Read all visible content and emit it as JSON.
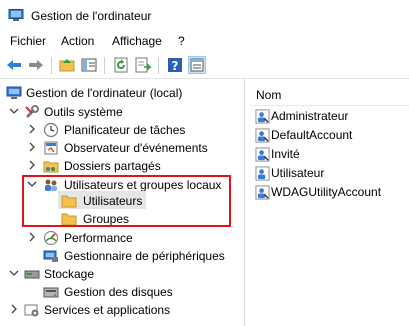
{
  "window": {
    "title": "Gestion de l'ordinateur"
  },
  "menu": [
    {
      "label": "Fichier"
    },
    {
      "label": "Action"
    },
    {
      "label": "Affichage"
    },
    {
      "label": "?"
    }
  ],
  "toolbar": {
    "buttons": [
      {
        "icon": "back-arrow-icon"
      },
      {
        "icon": "forward-arrow-icon"
      },
      {
        "icon": "up-folder-icon"
      },
      {
        "icon": "show-hide-tree-icon"
      },
      {
        "icon": "refresh-icon"
      },
      {
        "icon": "export-list-icon"
      },
      {
        "icon": "help-icon"
      },
      {
        "icon": "properties-icon",
        "active": true
      }
    ]
  },
  "tree": {
    "root": "Gestion de l'ordinateur (local)",
    "system_tools": "Outils système",
    "task_scheduler": "Planificateur de tâches",
    "event_viewer": "Observateur d'événements",
    "shared_folders": "Dossiers partagés",
    "local_users_groups": "Utilisateurs et groupes locaux",
    "users": "Utilisateurs",
    "groups": "Groupes",
    "performance": "Performance",
    "device_manager": "Gestionnaire de périphériques",
    "storage": "Stockage",
    "disk_management": "Gestion des disques",
    "services_apps": "Services et applications",
    "selected": "Utilisateurs"
  },
  "list": {
    "column": "Nom",
    "items": [
      "Administrateur",
      "DefaultAccount",
      "Invité",
      "Utilisateur",
      "WDAGUtilityAccount"
    ]
  },
  "colors": {
    "selection": "#e5e5e5",
    "highlight_border": "#e0141e",
    "folder": "#f2c14e",
    "accent": "#2b6cb0"
  }
}
